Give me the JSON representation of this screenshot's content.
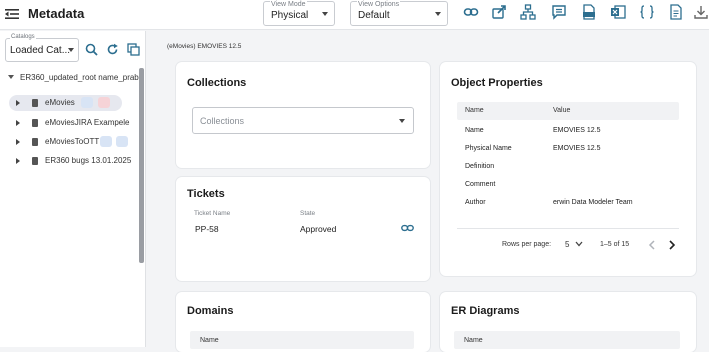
{
  "header": {
    "title": "Metadata",
    "view_mode": {
      "label": "View Mode",
      "value": "Physical"
    },
    "view_options": {
      "label": "View Options",
      "value": "Default"
    },
    "toolbar_icons": [
      "link-icon",
      "share-icon",
      "hierarchy-icon",
      "comment-icon",
      "csv-icon",
      "excel-icon",
      "json-icon",
      "pdf-icon",
      "download-icon"
    ]
  },
  "sidebar": {
    "catalogs": {
      "label": "Catalogs",
      "value": "Loaded Cat..."
    },
    "root": "ER360_updated_root name_prabh",
    "items": [
      {
        "label": "eMovies",
        "active": true
      },
      {
        "label": "eMoviesJIRA Exampele",
        "active": false
      },
      {
        "label": "eMoviesToOTT",
        "active": false
      },
      {
        "label": "ER360 bugs 13.01.2025",
        "active": false
      }
    ]
  },
  "breadcrumb": "(eMovies) EMOVIES 12.5",
  "collections": {
    "title": "Collections",
    "placeholder": "Collections"
  },
  "tickets": {
    "title": "Tickets",
    "col_name": "Ticket Name",
    "col_state": "State",
    "name": "PP-58",
    "state": "Approved"
  },
  "properties": {
    "title": "Object Properties",
    "col_name": "Name",
    "col_value": "Value",
    "rows": [
      {
        "name": "Name",
        "value": "EMOVIES 12.5"
      },
      {
        "name": "Physical Name",
        "value": "EMOVIES 12.5"
      },
      {
        "name": "Definition",
        "value": ""
      },
      {
        "name": "Comment",
        "value": ""
      },
      {
        "name": "Author",
        "value": "erwin Data Modeler Team"
      }
    ],
    "rows_per_page_label": "Rows per page:",
    "rows_per_page": "5",
    "range": "1–5 of 15"
  },
  "domains": {
    "title": "Domains",
    "col_name": "Name"
  },
  "er_diagrams": {
    "title": "ER Diagrams",
    "col_name": "Name"
  },
  "colors": {
    "accent": "#2c6e8f",
    "badge_blue": "#d8e4f5",
    "badge_red": "#f6d3d7"
  }
}
